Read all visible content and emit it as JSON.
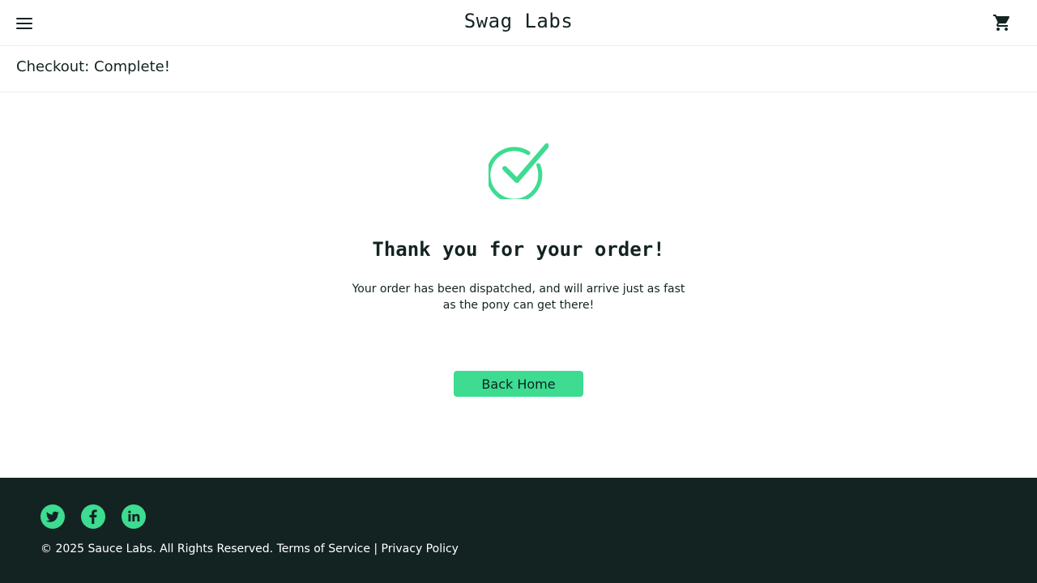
{
  "header": {
    "menu_icon": "hamburger-menu-icon",
    "app_title": "Swag Labs",
    "cart_icon": "shopping-cart-icon"
  },
  "secondary_header": {
    "title": "Checkout: Complete!"
  },
  "complete": {
    "icon": "check-circle-icon",
    "heading": "Thank you for your order!",
    "message": "Your order has been dispatched, and will arrive just as fast as the pony can get there!",
    "button_label": "Back Home"
  },
  "footer": {
    "social": [
      {
        "name": "Twitter",
        "icon": "twitter-icon"
      },
      {
        "name": "Facebook",
        "icon": "facebook-icon"
      },
      {
        "name": "LinkedIn",
        "icon": "linkedin-icon"
      }
    ],
    "copyright": "© 2025 Sauce Labs. All Rights Reserved. Terms of Service | Privacy Policy"
  },
  "colors": {
    "accent": "#3ddc91",
    "dark": "#132322",
    "divider": "#ededed",
    "background": "#ffffff"
  }
}
